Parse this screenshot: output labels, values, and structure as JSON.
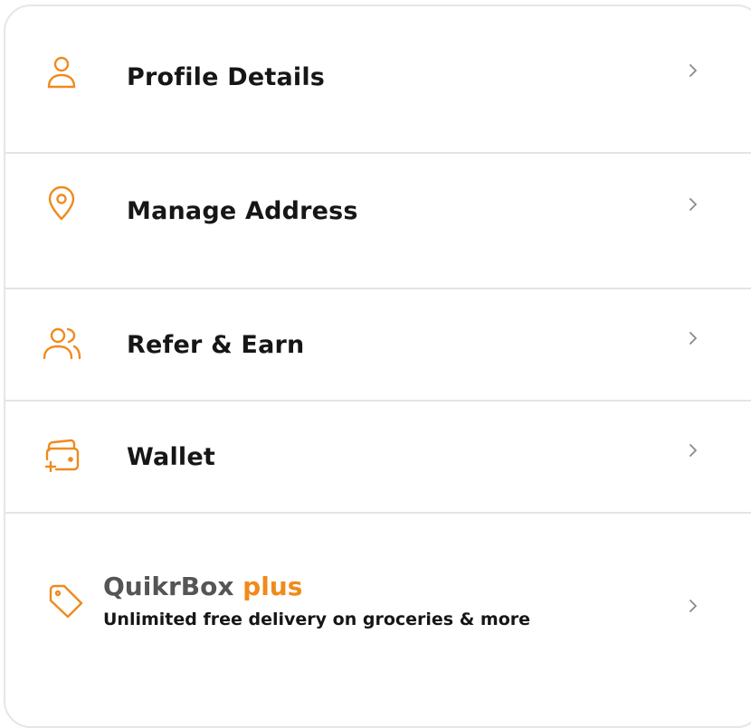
{
  "menu": {
    "items": [
      {
        "label": "Profile Details",
        "icon": "user-icon"
      },
      {
        "label": "Manage Address",
        "icon": "location-pin-icon"
      },
      {
        "label": "Refer & Earn",
        "icon": "users-icon"
      },
      {
        "label": "Wallet",
        "icon": "wallet-icon"
      }
    ]
  },
  "promo": {
    "icon": "tag-icon",
    "brand": "QuikrBox",
    "plus_word": "plus",
    "subtitle": "Unlimited free delivery on groceries & more"
  },
  "colors": {
    "accent": "#f08a1c",
    "divider": "#e4e4e4",
    "text": "#161616",
    "brand_gray": "#555555",
    "chevron": "#8a8a8a"
  }
}
